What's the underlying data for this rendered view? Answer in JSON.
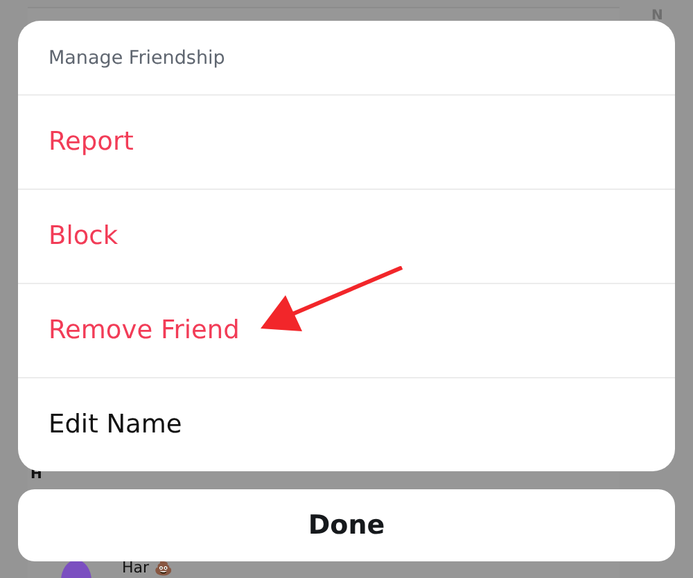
{
  "background": {
    "index_letter": "N",
    "section_letter": "H",
    "friend": {
      "name": "Har",
      "emoji": "💩"
    }
  },
  "sheet": {
    "title": "Manage Friendship",
    "items": [
      {
        "label": "Report",
        "kind": "destructive"
      },
      {
        "label": "Block",
        "kind": "destructive"
      },
      {
        "label": "Remove Friend",
        "kind": "destructive"
      },
      {
        "label": "Edit Name",
        "kind": "default"
      }
    ],
    "done": "Done"
  },
  "annotation": {
    "kind": "arrow"
  }
}
